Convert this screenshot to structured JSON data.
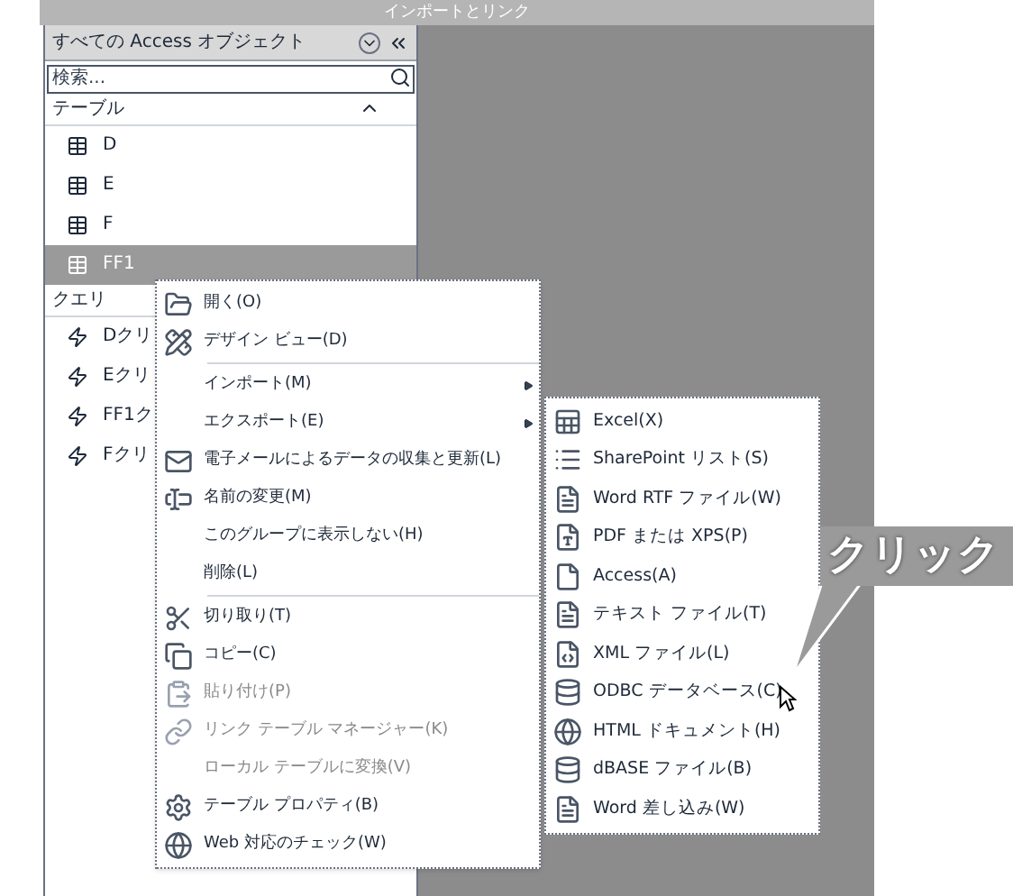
{
  "window": {
    "title": "インポートとリンク"
  },
  "nav_pane": {
    "title": "すべての Access オブジェクト",
    "search": {
      "placeholder": "検索..."
    },
    "groups": [
      {
        "label": "テーブル",
        "kind": "table",
        "items": [
          {
            "label": "D",
            "selected": false
          },
          {
            "label": "E",
            "selected": false
          },
          {
            "label": "F",
            "selected": false
          },
          {
            "label": "FF1",
            "selected": true
          }
        ]
      },
      {
        "label": "クエリ",
        "kind": "query",
        "items": [
          {
            "label": "Dクリ",
            "selected": false
          },
          {
            "label": "Eクリ",
            "selected": false
          },
          {
            "label": "FF1ク",
            "selected": false
          },
          {
            "label": "Fクリ",
            "selected": false
          }
        ]
      }
    ]
  },
  "context_menu": [
    {
      "label": "開く(O)",
      "kind": "item",
      "disabled": false,
      "submenu": false
    },
    {
      "label": "デザイン ビュー(D)",
      "kind": "item",
      "disabled": false,
      "submenu": false
    },
    {
      "kind": "separator"
    },
    {
      "label": "インポート(M)",
      "kind": "item",
      "disabled": false,
      "submenu": true
    },
    {
      "label": "エクスポート(E)",
      "kind": "item",
      "disabled": false,
      "submenu": true
    },
    {
      "label": "電子メールによるデータの収集と更新(L)",
      "kind": "item",
      "disabled": false,
      "submenu": false
    },
    {
      "label": "名前の変更(M)",
      "kind": "item",
      "disabled": false,
      "submenu": false
    },
    {
      "label": "このグループに表示しない(H)",
      "kind": "item",
      "disabled": false,
      "submenu": false
    },
    {
      "label": "削除(L)",
      "kind": "item",
      "disabled": false,
      "submenu": false
    },
    {
      "kind": "separator"
    },
    {
      "label": "切り取り(T)",
      "kind": "item",
      "disabled": false,
      "submenu": false
    },
    {
      "label": "コピー(C)",
      "kind": "item",
      "disabled": false,
      "submenu": false
    },
    {
      "label": "貼り付け(P)",
      "kind": "item",
      "disabled": true,
      "submenu": false
    },
    {
      "label": "リンク テーブル マネージャー(K)",
      "kind": "item",
      "disabled": true,
      "submenu": false
    },
    {
      "label": "ローカル テーブルに変換(V)",
      "kind": "item",
      "disabled": true,
      "submenu": false
    },
    {
      "label": "テーブル プロパティ(B)",
      "kind": "item",
      "disabled": false,
      "submenu": false
    },
    {
      "label": "Web 対応のチェック(W)",
      "kind": "item",
      "disabled": false,
      "submenu": false
    }
  ],
  "export_submenu": [
    "Excel(X)",
    "SharePoint リスト(S)",
    "Word RTF ファイル(W)",
    "PDF または XPS(P)",
    "Access(A)",
    "テキスト ファイル(T)",
    "XML ファイル(L)",
    "ODBC データベース(C)",
    "HTML ドキュメント(H)",
    "dBASE ファイル(B)",
    "Word 差し込み(W)"
  ],
  "callout": {
    "text": "クリック"
  }
}
